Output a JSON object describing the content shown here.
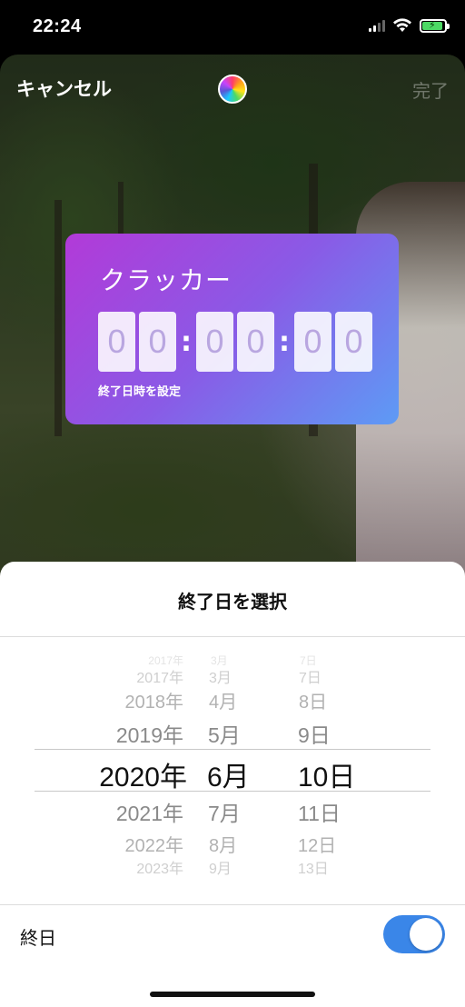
{
  "status_bar": {
    "time": "22:24"
  },
  "editor": {
    "cancel_label": "キャンセル",
    "done_label": "完了",
    "sticker": {
      "title": "クラッカー",
      "digits": [
        "0",
        "0",
        "0",
        "0",
        "0",
        "0"
      ],
      "separator": ":",
      "subtitle": "終了日時を設定"
    }
  },
  "sheet": {
    "title": "終了日を選択",
    "picker": {
      "years": [
        "2017年",
        "2018年",
        "2019年",
        "2020年",
        "2021年",
        "2022年",
        "2023年"
      ],
      "months": [
        "3月",
        "4月",
        "5月",
        "6月",
        "7月",
        "8月",
        "9月"
      ],
      "days": [
        "7日",
        "8日",
        "9日",
        "10日",
        "11日",
        "12日",
        "13日"
      ],
      "selected": {
        "year": "2020年",
        "month": "6月",
        "day": "10日"
      }
    },
    "all_day_label": "終日",
    "all_day_on": true
  },
  "colors": {
    "toggle_on": "#3a86e8",
    "sticker_start": "#b23ad8",
    "sticker_end": "#5d9bf5"
  }
}
